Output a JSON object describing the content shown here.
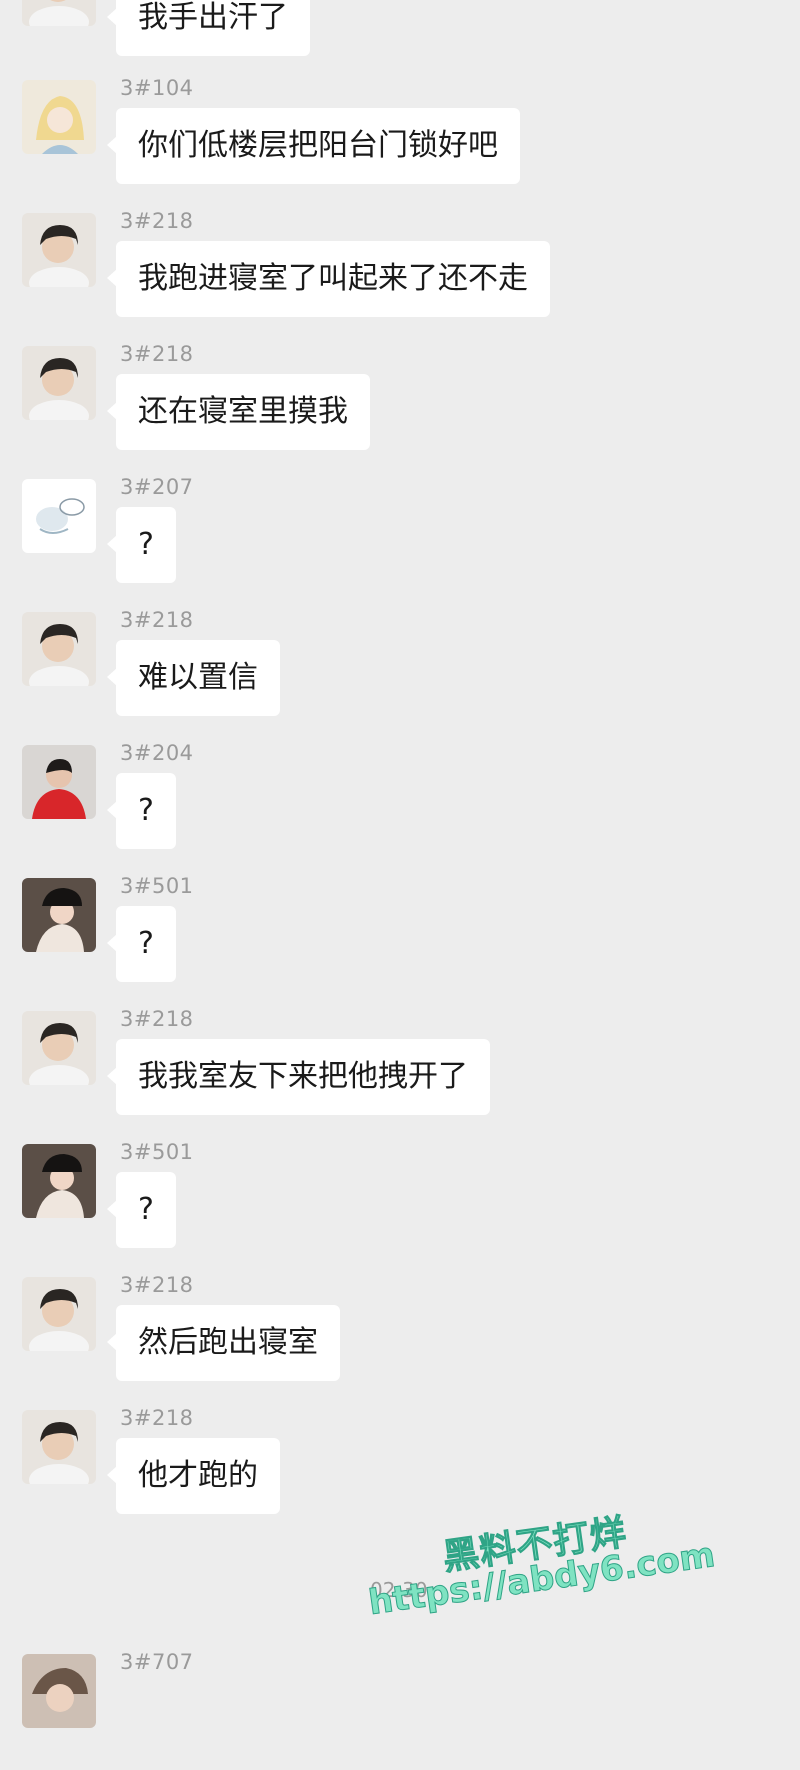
{
  "messages": [
    {
      "sender": "",
      "text": "我手出汗了",
      "avatar": "avatar-218"
    },
    {
      "sender": "3#104",
      "text": "你们低楼层把阳台门锁好吧",
      "avatar": "avatar-anime"
    },
    {
      "sender": "3#218",
      "text": "我跑进寝室了叫起来了还不走",
      "avatar": "avatar-218"
    },
    {
      "sender": "3#218",
      "text": "还在寝室里摸我",
      "avatar": "avatar-218"
    },
    {
      "sender": "3#207",
      "text": "?",
      "avatar": "avatar-sketch"
    },
    {
      "sender": "3#218",
      "text": "难以置信",
      "avatar": "avatar-218"
    },
    {
      "sender": "3#204",
      "text": "?",
      "avatar": "avatar-red"
    },
    {
      "sender": "3#501",
      "text": "?",
      "avatar": "avatar-hat"
    },
    {
      "sender": "3#218",
      "text": "我我室友下来把他拽开了",
      "avatar": "avatar-218"
    },
    {
      "sender": "3#501",
      "text": "?",
      "avatar": "avatar-hat"
    },
    {
      "sender": "3#218",
      "text": "然后跑出寝室",
      "avatar": "avatar-218"
    },
    {
      "sender": "3#218",
      "text": "他才跑的",
      "avatar": "avatar-218"
    }
  ],
  "timestamp": "02:30",
  "last_message": {
    "sender": "3#707",
    "avatar": "avatar-partial"
  },
  "watermark": {
    "title": "黑料不打烊",
    "url": "https://abdy6.com"
  },
  "colors": {
    "background": "#ededed",
    "bubble": "#ffffff",
    "meta_text": "#9a9a9a",
    "watermark": "#7fe3c2"
  }
}
